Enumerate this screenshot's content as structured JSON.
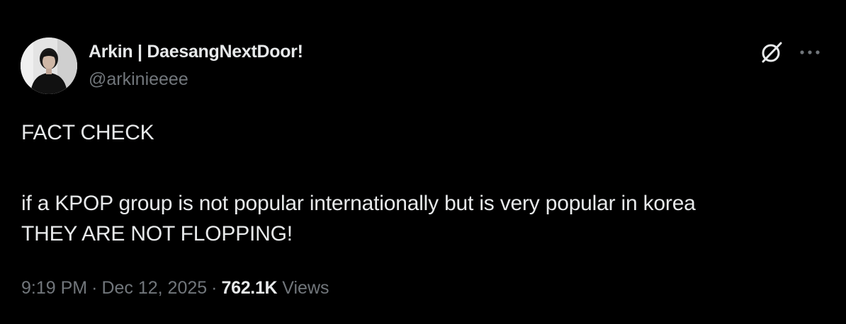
{
  "author": {
    "display_name": "Arkin | DaesangNextDoor!",
    "handle": "@arkinieeee"
  },
  "tweet": {
    "lines": [
      "FACT CHECK",
      "if a KPOP group is not popular internationally but is very popular in korea",
      "THEY ARE NOT FLOPPING!"
    ]
  },
  "meta": {
    "time": "9:19 PM",
    "separator": "·",
    "date": "Dec 12, 2025",
    "views_count": "762.1K",
    "views_label": "Views"
  },
  "icons": {
    "grok": "grok-icon",
    "more": "more-options-icon"
  },
  "colors": {
    "background": "#000000",
    "primary_text": "#e7e9ea",
    "secondary_text": "#71767b"
  }
}
